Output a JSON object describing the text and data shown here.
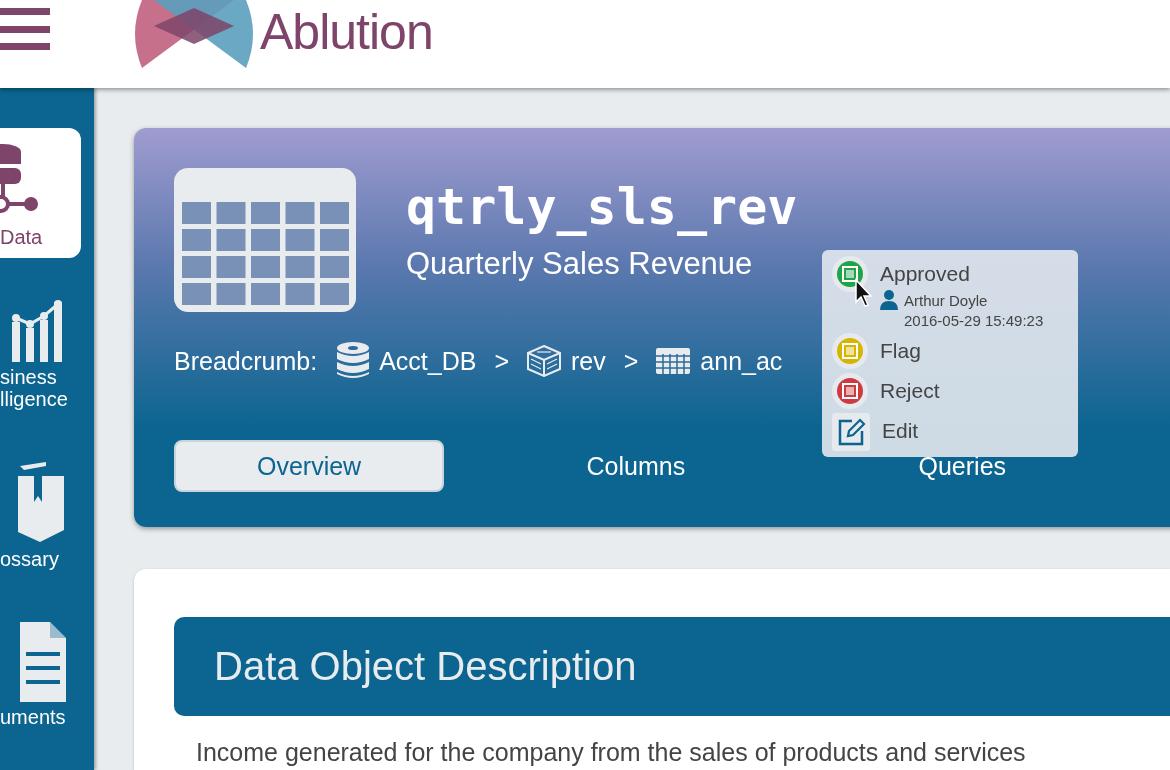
{
  "header": {
    "logo_text": "Ablution"
  },
  "sidebar": {
    "items": [
      {
        "label": "Data",
        "kind": "data",
        "selected": true
      },
      {
        "label": "siness",
        "label_2": "lligence",
        "kind": "chart",
        "selected": false
      },
      {
        "label": "ossary",
        "kind": "book",
        "selected": false
      },
      {
        "label": "uments",
        "kind": "document",
        "selected": false
      }
    ]
  },
  "hero": {
    "title": "qtrly_sls_rev",
    "subtitle": "Quarterly Sales Revenue",
    "breadcrumb": {
      "label": "Breadcrumb:",
      "separator": ">",
      "items": [
        {
          "label": "Acct_DB",
          "kind": "database"
        },
        {
          "label": "rev",
          "kind": "schema"
        },
        {
          "label": "ann_ac",
          "kind": "table"
        }
      ]
    },
    "tabs": [
      {
        "label": "Overview",
        "selected": true
      },
      {
        "label": "Columns",
        "selected": false
      },
      {
        "label": "Queries",
        "selected": false
      }
    ]
  },
  "status_menu": {
    "items": [
      {
        "label": "Approved",
        "kind": "status",
        "color": "#1fa447",
        "user": "Arthur Doyle",
        "time": "2016-05-29 15:49:23"
      },
      {
        "label": "Flag",
        "kind": "status",
        "color": "#d6b400"
      },
      {
        "label": "Reject",
        "kind": "status",
        "color": "#cc3b40"
      },
      {
        "label": "Edit",
        "kind": "edit"
      }
    ]
  },
  "description": {
    "heading": "Data Object Description",
    "text": "Income generated for the company from the sales of products and services"
  }
}
